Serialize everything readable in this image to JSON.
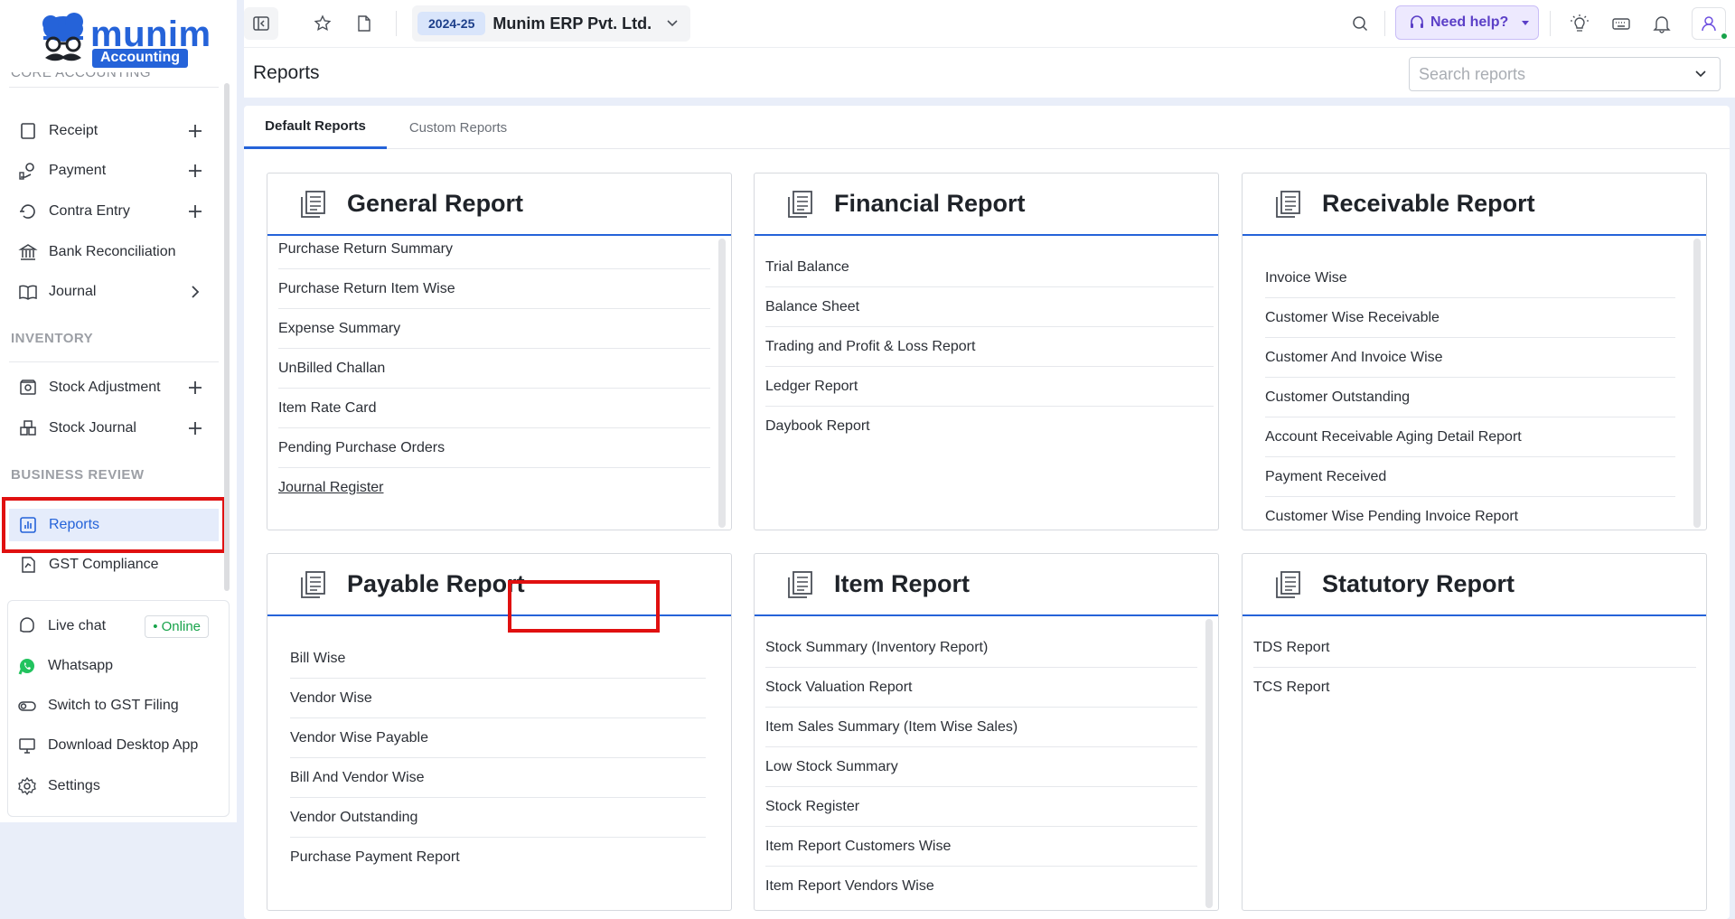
{
  "brand": {
    "name": "munim",
    "tag": "Accounting"
  },
  "sidebar": {
    "cut_section": "CORE ACCOUNTING",
    "core": [
      {
        "label": "Receipt",
        "icon": "receipt-icon",
        "action": "plus"
      },
      {
        "label": "Payment",
        "icon": "payment-icon",
        "action": "plus"
      },
      {
        "label": "Contra Entry",
        "icon": "contra-entry-icon",
        "action": "plus"
      },
      {
        "label": "Bank Reconciliation",
        "icon": "bank-icon",
        "action": ""
      },
      {
        "label": "Journal",
        "icon": "journal-book-icon",
        "action": "chevron"
      }
    ],
    "inventory_title": "INVENTORY",
    "inventory": [
      {
        "label": "Stock Adjustment",
        "icon": "stock-adjustment-icon",
        "action": "plus"
      },
      {
        "label": "Stock Journal",
        "icon": "stock-journal-icon",
        "action": "plus"
      }
    ],
    "business_title": "BUSINESS REVIEW",
    "business": [
      {
        "label": "Reports",
        "icon": "reports-icon",
        "active": true
      },
      {
        "label": "GST Compliance",
        "icon": "gst-icon",
        "active": false
      }
    ],
    "support": [
      {
        "label": "Live chat",
        "icon": "live-chat-icon",
        "badge": "• Online"
      },
      {
        "label": "Whatsapp",
        "icon": "whatsapp-icon"
      },
      {
        "label": "Switch to GST Filing",
        "icon": "toggle-icon"
      },
      {
        "label": "Download Desktop App",
        "icon": "desktop-icon"
      },
      {
        "label": "Settings",
        "icon": "settings-icon"
      }
    ]
  },
  "topbar": {
    "fy": "2024-25",
    "company": "Munim ERP Pvt. Ltd.",
    "help": "Need help?"
  },
  "page": {
    "title": "Reports",
    "search_placeholder": "Search reports"
  },
  "tabs": [
    "Default Reports",
    "Custom Reports"
  ],
  "cards": [
    {
      "title": "General Report",
      "items": [
        "Purchase Return Summary",
        "Purchase Return Item Wise",
        "Expense Summary",
        "UnBilled Challan",
        "Item Rate Card",
        "Pending Purchase Orders",
        "Journal Register"
      ]
    },
    {
      "title": "Financial Report",
      "items": [
        "Trial Balance",
        "Balance Sheet",
        "Trading and Profit & Loss Report",
        "Ledger Report",
        "Daybook Report"
      ]
    },
    {
      "title": "Receivable Report",
      "items": [
        "Invoice Wise",
        "Customer Wise Receivable",
        "Customer And Invoice Wise",
        "Customer Outstanding",
        "Account Receivable Aging Detail Report",
        "Payment Received",
        "Customer Wise Pending Invoice Report"
      ]
    },
    {
      "title": "Payable Report",
      "items": [
        "Bill Wise",
        "Vendor Wise",
        "Vendor Wise Payable",
        "Bill And Vendor Wise",
        "Vendor Outstanding",
        "Purchase Payment Report"
      ]
    },
    {
      "title": "Item Report",
      "items": [
        "Stock Summary (Inventory Report)",
        "Stock Valuation Report",
        "Item Sales Summary (Item Wise Sales)",
        "Low Stock Summary",
        "Stock Register",
        "Item Report Customers Wise",
        "Item Report Vendors Wise"
      ]
    },
    {
      "title": "Statutory Report",
      "items": [
        "TDS Report",
        "TCS Report"
      ]
    }
  ]
}
